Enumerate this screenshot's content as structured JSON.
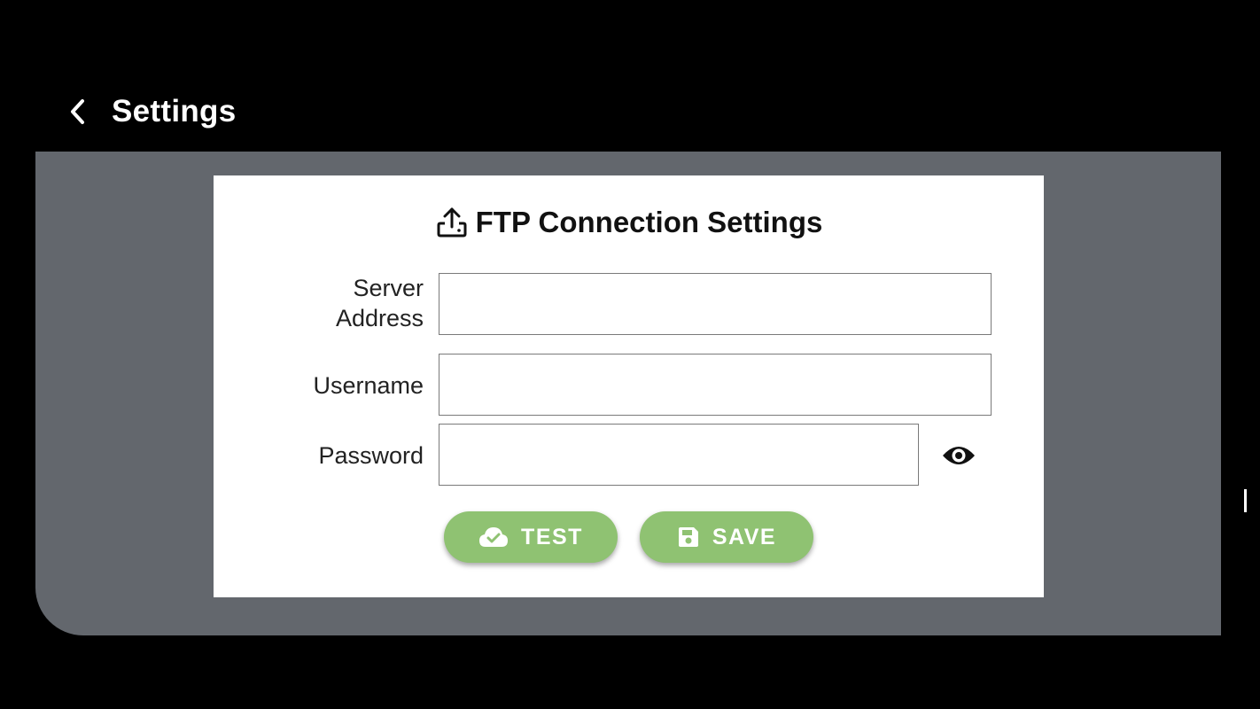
{
  "header": {
    "back_icon": "chevron-left-icon",
    "title": "Settings"
  },
  "card": {
    "title_icon": "upload-tray-icon",
    "title": "FTP Connection Settings"
  },
  "form": {
    "server_address": {
      "label": "Server Address",
      "value": "",
      "placeholder": ""
    },
    "username": {
      "label": "Username",
      "value": "",
      "placeholder": ""
    },
    "password": {
      "label": "Password",
      "value": "",
      "placeholder": "",
      "toggle_icon": "eye-icon"
    }
  },
  "actions": {
    "test": {
      "label": "TEST",
      "icon": "cloud-check-icon"
    },
    "save": {
      "label": "SAVE",
      "icon": "floppy-disk-icon"
    }
  },
  "colors": {
    "background": "#000000",
    "panel": "#63676d",
    "card": "#ffffff",
    "button": "#8fc272",
    "button_text": "#ffffff"
  }
}
